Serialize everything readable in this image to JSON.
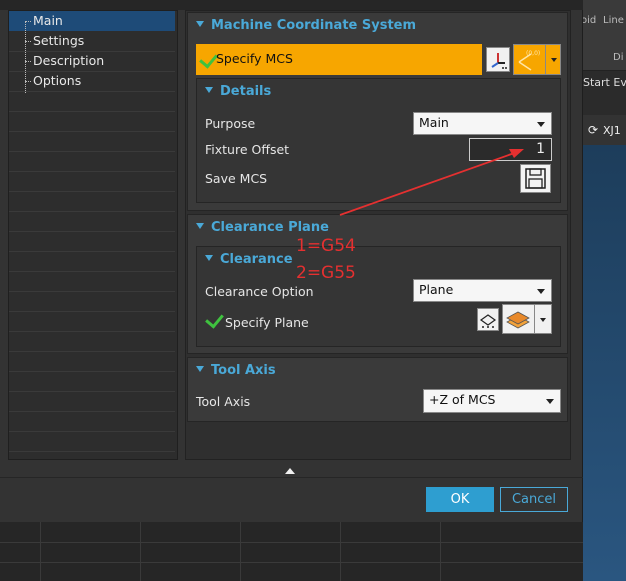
{
  "background_app": {
    "top_labels": [
      "oid",
      "Line"
    ],
    "sub_label": "Di",
    "start_event": "Start Eve",
    "tab_label": "XJ1"
  },
  "nav": {
    "items": [
      {
        "label": "Main",
        "selected": true
      },
      {
        "label": "Settings",
        "selected": false
      },
      {
        "label": "Description",
        "selected": false
      },
      {
        "label": "Options",
        "selected": false
      }
    ]
  },
  "mcs": {
    "title": "Machine Coordinate System",
    "specify_label": "Specify MCS",
    "details": {
      "title": "Details",
      "purpose_label": "Purpose",
      "purpose_value": "Main",
      "fixture_label": "Fixture Offset",
      "fixture_value": "1",
      "save_label": "Save MCS"
    }
  },
  "clearance": {
    "title": "Clearance Plane",
    "sub_title": "Clearance",
    "option_label": "Clearance Option",
    "option_value": "Plane",
    "specify_plane_label": "Specify Plane"
  },
  "tool_axis": {
    "title": "Tool Axis",
    "label": "Tool Axis",
    "value": "+Z of MCS"
  },
  "buttons": {
    "ok": "OK",
    "cancel": "Cancel"
  },
  "annotation": {
    "line1": "1=G54",
    "line2": "2=G55"
  },
  "colors": {
    "accent_blue": "#4aa9d8",
    "highlight_orange": "#f7a600",
    "ok_blue": "#2e9ed0",
    "annotation_red": "#e53030"
  }
}
